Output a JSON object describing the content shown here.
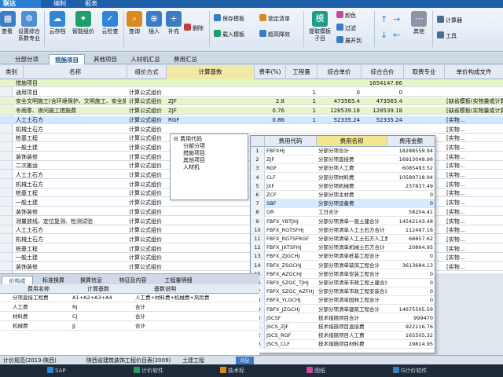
{
  "titlebar": {
    "app": "联达",
    "menus": [
      "编制",
      "报表"
    ]
  },
  "ribbon": {
    "big": [
      {
        "label": "查看",
        "icon": "grid-icon",
        "color": "#3b7dc4"
      },
      {
        "label": "设置综合系数专业",
        "icon": "gear-grid-icon",
        "color": "#4f8fd0"
      },
      {
        "label": "云存档",
        "icon": "cloud-icon",
        "color": "#2f86d6"
      },
      {
        "label": "智能组价",
        "icon": "smart-price-icon",
        "color": "#1f9d6b"
      },
      {
        "label": "云检查",
        "icon": "cloud-check-icon",
        "color": "#2f86d6"
      },
      {
        "label": "查询",
        "icon": "search-icon",
        "color": "#d98a1d"
      },
      {
        "label": "插入",
        "icon": "insert-icon",
        "color": "#3b7dc4"
      },
      {
        "label": "补充",
        "icon": "supplement-icon",
        "color": "#3b7dc4"
      },
      {
        "label": "提取模板子目",
        "icon": "template-icon",
        "color": "#1f9d8a"
      },
      {
        "label": "其他",
        "icon": "other-icon",
        "color": "#8a96a8"
      }
    ],
    "small": [
      {
        "label": "删除",
        "icon": "delete-icon",
        "color": "#c83b3b"
      },
      {
        "label": "保存模板",
        "icon": "save-template-icon",
        "color": "#3b7dc4"
      },
      {
        "label": "载入模板",
        "icon": "load-template-icon",
        "color": "#1f9d6b"
      },
      {
        "label": "锁定清单",
        "icon": "lock-icon",
        "color": "#d98a1d"
      },
      {
        "label": "超高降效",
        "icon": "efficiency-icon",
        "color": "#3b7dc4"
      },
      {
        "label": "颜色",
        "icon": "color-icon",
        "color": "#c84a9b"
      },
      {
        "label": "过滤",
        "icon": "filter-icon",
        "color": "#3b7dc4"
      },
      {
        "label": "展开到",
        "icon": "expand-icon",
        "color": "#3b7dc4"
      },
      {
        "label": "计算器",
        "icon": "calculator-icon",
        "color": "#4a6b8f"
      },
      {
        "label": "工具",
        "icon": "tools-icon",
        "color": "#4a6b8f"
      }
    ]
  },
  "tabs": [
    "分部分项",
    "措施项目",
    "其他项目",
    "人材机汇总",
    "费用汇总"
  ],
  "grid": {
    "headers": [
      "类别",
      "名称",
      "组价方式",
      "计算基数",
      "费率(%)",
      "工程量",
      "综合单价",
      "综合合价",
      "取费专业",
      "单价构成文件"
    ],
    "rows": [
      {
        "name": "措施项目",
        "method": "",
        "base": "",
        "rate": "",
        "qty": "",
        "unit": "",
        "total": "1654147.66",
        "spec": "",
        "file": "",
        "style": "green"
      },
      {
        "name": "通用项目",
        "method": "计算公式组价",
        "base": "",
        "rate": "",
        "qty": "1",
        "unit": "0",
        "total": "0",
        "spec": "",
        "file": "",
        "style": ""
      },
      {
        "name": "安全文明施工(含环境保护、文明施工、安全施工、临时设施)",
        "method": "计算公式组价",
        "base": "ZJF",
        "rate": "2.8",
        "qty": "1",
        "unit": "473565.4",
        "total": "473565.4",
        "spec": "",
        "file": "[缺省模板(实物量或计算公式组价)]",
        "style": "green"
      },
      {
        "name": "冬雨季、夜间施工措施费",
        "method": "计算公式组价",
        "base": "ZJF",
        "rate": "0.76",
        "qty": "1",
        "unit": "128539.18",
        "total": "128539.18",
        "spec": "",
        "file": "[缺省模板(实物量或计算公式组价)]",
        "style": "green"
      },
      {
        "name": "人工土石方",
        "method": "计算公式组价",
        "base": "RGF",
        "rate": "0.86",
        "qty": "1",
        "unit": "52335.24",
        "total": "52335.24",
        "spec": "",
        "file": "[实物...",
        "style": "sel"
      },
      {
        "name": "机械土石方",
        "method": "计算公式组价",
        "base": "",
        "rate": "",
        "qty": "",
        "unit": "",
        "total": "",
        "spec": "",
        "file": "[实物...",
        "style": ""
      },
      {
        "name": "桩基工程",
        "method": "计算公式组价",
        "base": "",
        "rate": "",
        "qty": "",
        "unit": "",
        "total": "",
        "spec": "",
        "file": "[实物...",
        "style": ""
      },
      {
        "name": "一般土建",
        "method": "计算公式组价",
        "base": "",
        "rate": "",
        "qty": "",
        "unit": "",
        "total": "",
        "spec": "",
        "file": "[实物...",
        "style": ""
      },
      {
        "name": "装饰装修",
        "method": "计算公式组价",
        "base": "",
        "rate": "",
        "qty": "",
        "unit": "",
        "total": "",
        "spec": "",
        "file": "[实物...",
        "style": ""
      },
      {
        "name": "二次搬运",
        "method": "计算公式组价",
        "base": "",
        "rate": "",
        "qty": "",
        "unit": "",
        "total": "",
        "spec": "",
        "file": "[实物...",
        "style": ""
      },
      {
        "name": "人工土石方",
        "method": "计算公式组价",
        "base": "",
        "rate": "",
        "qty": "",
        "unit": "",
        "total": "",
        "spec": "",
        "file": "[实物...",
        "style": ""
      },
      {
        "name": "机械土石方",
        "method": "计算公式组价",
        "base": "",
        "rate": "",
        "qty": "",
        "unit": "",
        "total": "",
        "spec": "",
        "file": "[实物...",
        "style": ""
      },
      {
        "name": "桩基工程",
        "method": "计算公式组价",
        "base": "",
        "rate": "",
        "qty": "",
        "unit": "",
        "total": "",
        "spec": "",
        "file": "[实物...",
        "style": ""
      },
      {
        "name": "一般土建",
        "method": "计算公式组价",
        "base": "",
        "rate": "",
        "qty": "",
        "unit": "",
        "total": "",
        "spec": "",
        "file": "[实物...",
        "style": ""
      },
      {
        "name": "装饰装修",
        "method": "计算公式组价",
        "base": "",
        "rate": "",
        "qty": "",
        "unit": "",
        "total": "",
        "spec": "",
        "file": "[实物...",
        "style": ""
      },
      {
        "name": "测量放线、定位复测、检测试验",
        "method": "计算公式组价",
        "base": "",
        "rate": "",
        "qty": "",
        "unit": "",
        "total": "",
        "spec": "",
        "file": "[实物...",
        "style": ""
      },
      {
        "name": "人工土石方",
        "method": "计算公式组价",
        "base": "",
        "rate": "",
        "qty": "",
        "unit": "",
        "total": "",
        "spec": "",
        "file": "[实物...",
        "style": ""
      },
      {
        "name": "机械土石方",
        "method": "计算公式组价",
        "base": "",
        "rate": "",
        "qty": "",
        "unit": "",
        "total": "",
        "spec": "",
        "file": "[实物...",
        "style": ""
      },
      {
        "name": "桩基工程",
        "method": "计算公式组价",
        "base": "",
        "rate": "",
        "qty": "",
        "unit": "",
        "total": "",
        "spec": "",
        "file": "[实物...",
        "style": ""
      },
      {
        "name": "一般土建",
        "method": "计算公式组价",
        "base": "",
        "rate": "",
        "qty": "",
        "unit": "",
        "total": "",
        "spec": "",
        "file": "[实物...",
        "style": ""
      },
      {
        "name": "装饰装修",
        "method": "计算公式组价",
        "base": "",
        "rate": "",
        "qty": "",
        "unit": "",
        "total": "",
        "spec": "",
        "file": "[实物...",
        "style": ""
      }
    ]
  },
  "tree": {
    "root": "费用代码",
    "items": [
      "分部分项",
      "措施项目",
      "其他项目",
      "人材机"
    ]
  },
  "popup": {
    "headers": [
      "费用代码",
      "费用名称",
      "费用金额"
    ],
    "rows": [
      {
        "i": "1",
        "code": "FBFXHJ",
        "name": "分部分项合计",
        "amount": "18288559.94"
      },
      {
        "i": "2",
        "code": "ZJF",
        "name": "分部分项直接费",
        "amount": "16913049.96"
      },
      {
        "i": "3",
        "code": "RGF",
        "name": "分部分项人工费",
        "amount": "6085493.52"
      },
      {
        "i": "4",
        "code": "CLF",
        "name": "分部分项材料费",
        "amount": "10589718.94"
      },
      {
        "i": "5",
        "code": "JXF",
        "name": "分部分项机械费",
        "amount": "237837.49"
      },
      {
        "i": "6",
        "code": "ZCF",
        "name": "分部分项主材费",
        "amount": "0"
      },
      {
        "i": "7",
        "code": "SBF",
        "name": "分部分项设备费",
        "amount": "0",
        "sel": true
      },
      {
        "i": "8",
        "code": "GR",
        "name": "工日合计",
        "amount": "58204.41"
      },
      {
        "i": "9",
        "code": "FBFX_YBTJHJ",
        "name": "分部分项清单一般土建合计",
        "amount": "14542143.48"
      },
      {
        "i": "10",
        "code": "FBFX_RGTSFHJ",
        "name": "分部分项清单人工土石方合计",
        "amount": "112497.16"
      },
      {
        "i": "11",
        "code": "FBFX_RGTSFRGF",
        "name": "分部分项清单人工土石方人工费",
        "amount": "68857.62"
      },
      {
        "i": "12",
        "code": "FBFX_JXTSFHJ",
        "name": "分部分项清单机械土石方合计",
        "amount": "20864.95"
      },
      {
        "i": "13",
        "code": "FBFX_ZJGCHJ",
        "name": "分部分项清单桩基工程合计",
        "amount": "0"
      },
      {
        "i": "14",
        "code": "FBFX_ZSGCHJ",
        "name": "分部分项清单装饰工程合计",
        "amount": "3613684.13"
      },
      {
        "i": "15",
        "code": "FBFX_AZGCHJ",
        "name": "分部分项清单安装工程合计",
        "amount": "0"
      },
      {
        "i": "16",
        "code": "FBFX_SZGC_TJHJ",
        "name": "分部分项清单市政工程土建合计",
        "amount": "0"
      },
      {
        "i": "17",
        "code": "FBFX_SZGC_AZFHJ",
        "name": "分部分项清单市政工程安装合计",
        "amount": "0"
      },
      {
        "i": "18",
        "code": "FBFX_YLGCHJ",
        "name": "分部分项清单园林工程合计",
        "amount": "0"
      },
      {
        "i": "19",
        "code": "FBFX_JZGCHJ",
        "name": "分部分项清单建筑工程合计",
        "amount": "14675505.59"
      },
      {
        "i": "20",
        "code": "JSCSF",
        "name": "技术措施项目合计",
        "amount": "999470"
      },
      {
        "i": "21",
        "code": "JSCS_ZJF",
        "name": "技术措施项目直接费",
        "amount": "922116.76"
      },
      {
        "i": "22",
        "code": "JSCS_RGF",
        "name": "技术措施项目人工费",
        "amount": "165505.32"
      },
      {
        "i": "23",
        "code": "JSCS_CLF",
        "name": "技术措施项目材料费",
        "amount": "19814.95"
      }
    ]
  },
  "bottom": {
    "tabs": [
      "价构成",
      "标准换算",
      "换算信息",
      "特征及内容",
      "工程量明细"
    ],
    "headers": [
      "费用名称",
      "计算基数",
      "基数说明"
    ],
    "rows": [
      {
        "name": "分项直接工程费",
        "base": "A1+A2+A3+A4",
        "desc": "人工费+材料费+机械费+风险费"
      },
      {
        "name": "人工费",
        "base": "RJ",
        "desc": "合计"
      },
      {
        "name": "材料费",
        "base": "CJ",
        "desc": "合计"
      },
      {
        "name": "机械费",
        "base": "JJ",
        "desc": "合计"
      }
    ]
  },
  "status": {
    "left": "计价规范(2013-陕西)",
    "mid": "陕西省建筑装饰工程价目表(2009)",
    "project": "土建工程",
    "badge": "0分"
  },
  "taskbar": [
    "SAP",
    "计价软件",
    "技术标",
    "图纸",
    "G计价软件"
  ]
}
